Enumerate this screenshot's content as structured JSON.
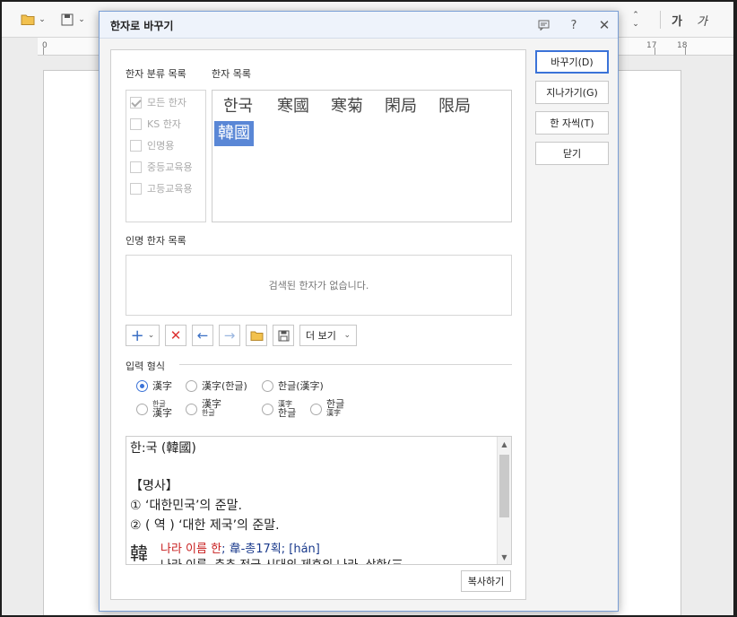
{
  "toolbar": {
    "font_sample_bold": "가",
    "font_sample_italic": "가"
  },
  "ruler": {
    "numbers": [
      "0",
      "17",
      "18"
    ]
  },
  "dialog": {
    "title": "한자로 바꾸기",
    "category_label": "한자 분류 목록",
    "hanja_list_label": "한자 목록",
    "categories": [
      {
        "label": "모든 한자",
        "checked": true
      },
      {
        "label": "KS 한자",
        "checked": false
      },
      {
        "label": "인명용",
        "checked": false
      },
      {
        "label": "중등교육용",
        "checked": false
      },
      {
        "label": "고등교육용",
        "checked": false
      }
    ],
    "hanja_candidates": [
      "한국",
      "寒國",
      "寒菊",
      "閑局",
      "限局",
      "韓國"
    ],
    "selected_index": 5,
    "name_label": "인명 한자 목록",
    "name_empty": "검색된 한자가 없습니다.",
    "more_view": "더 보기",
    "format_label": "입력 형식",
    "formats": {
      "f1": "漢字",
      "f2": "漢字(한글)",
      "f3": "한글(漢字)",
      "f4_top": "한글",
      "f4_bottom": "漢字",
      "f5_top": "漢字",
      "f5_bottom": "한글",
      "f6_top": "漢字",
      "f6_bottom": "한글",
      "f7_top": "한글",
      "f7_bottom": "漢字"
    },
    "definition": {
      "line1": "한:국 (韓國)",
      "line2": "【명사】",
      "line3": "① ‘대한민국’의 준말.",
      "line4": "② ( 역 ) ‘대한 제국’의 준말.",
      "hanja_char": "韓",
      "line5_red": "나라 이름 한",
      "line5_rest": "; 韋-총17획; [hán]",
      "line6": "나라 이름, 춘추 전국 시대의 제후의 나라, 삼한(三"
    },
    "copy_button": "복사하기",
    "buttons": {
      "replace": "바꾸기(D)",
      "skip": "지나가기(G)",
      "one_char": "한 자씩(T)",
      "close": "닫기"
    }
  }
}
